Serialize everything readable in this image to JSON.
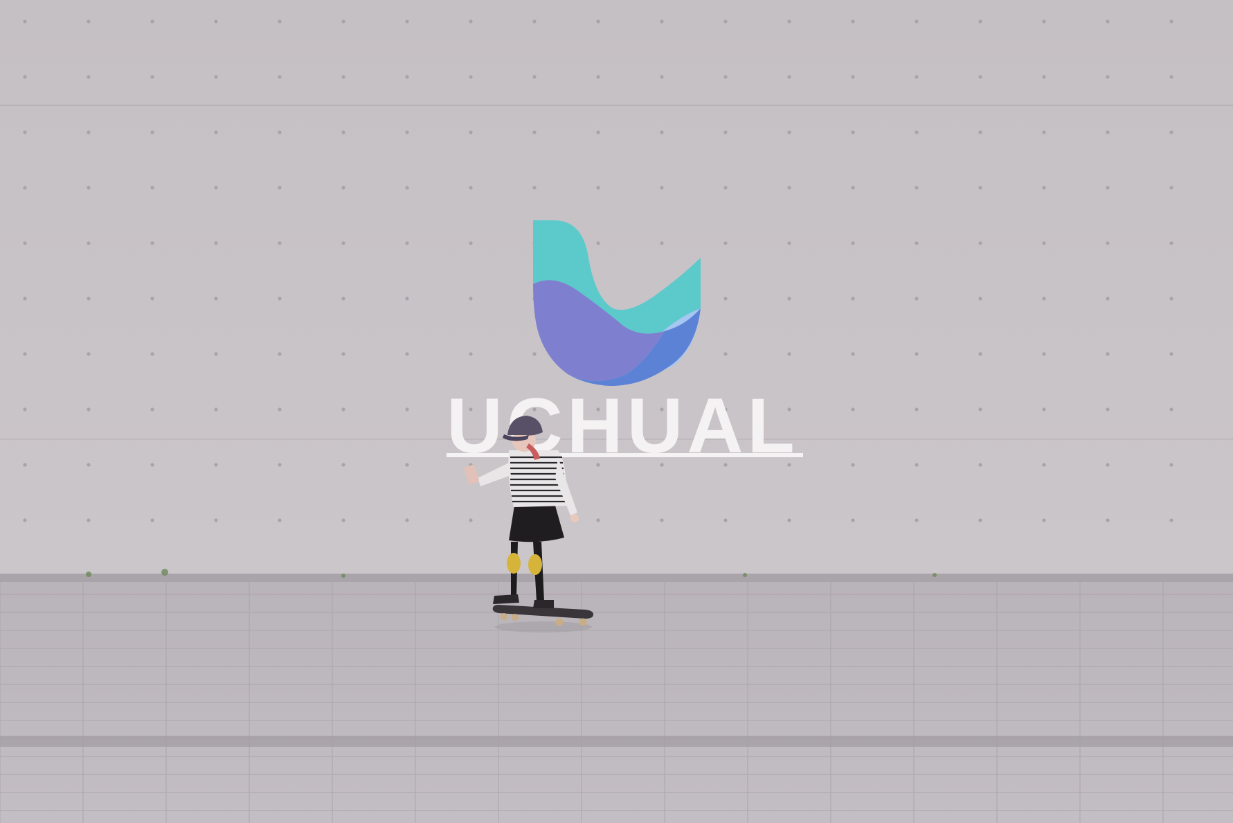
{
  "brand": {
    "wordmark": "UCHUAL",
    "colors": {
      "teal": "#5cc9cb",
      "light_blue": "#a9c7f2",
      "purple": "#7f7fd0",
      "blue": "#5c82d6",
      "wordmark": "#f4f2f3"
    }
  },
  "scene": {
    "wall_color": "#c8c3c7",
    "ground_color": "#b8b3b8"
  }
}
